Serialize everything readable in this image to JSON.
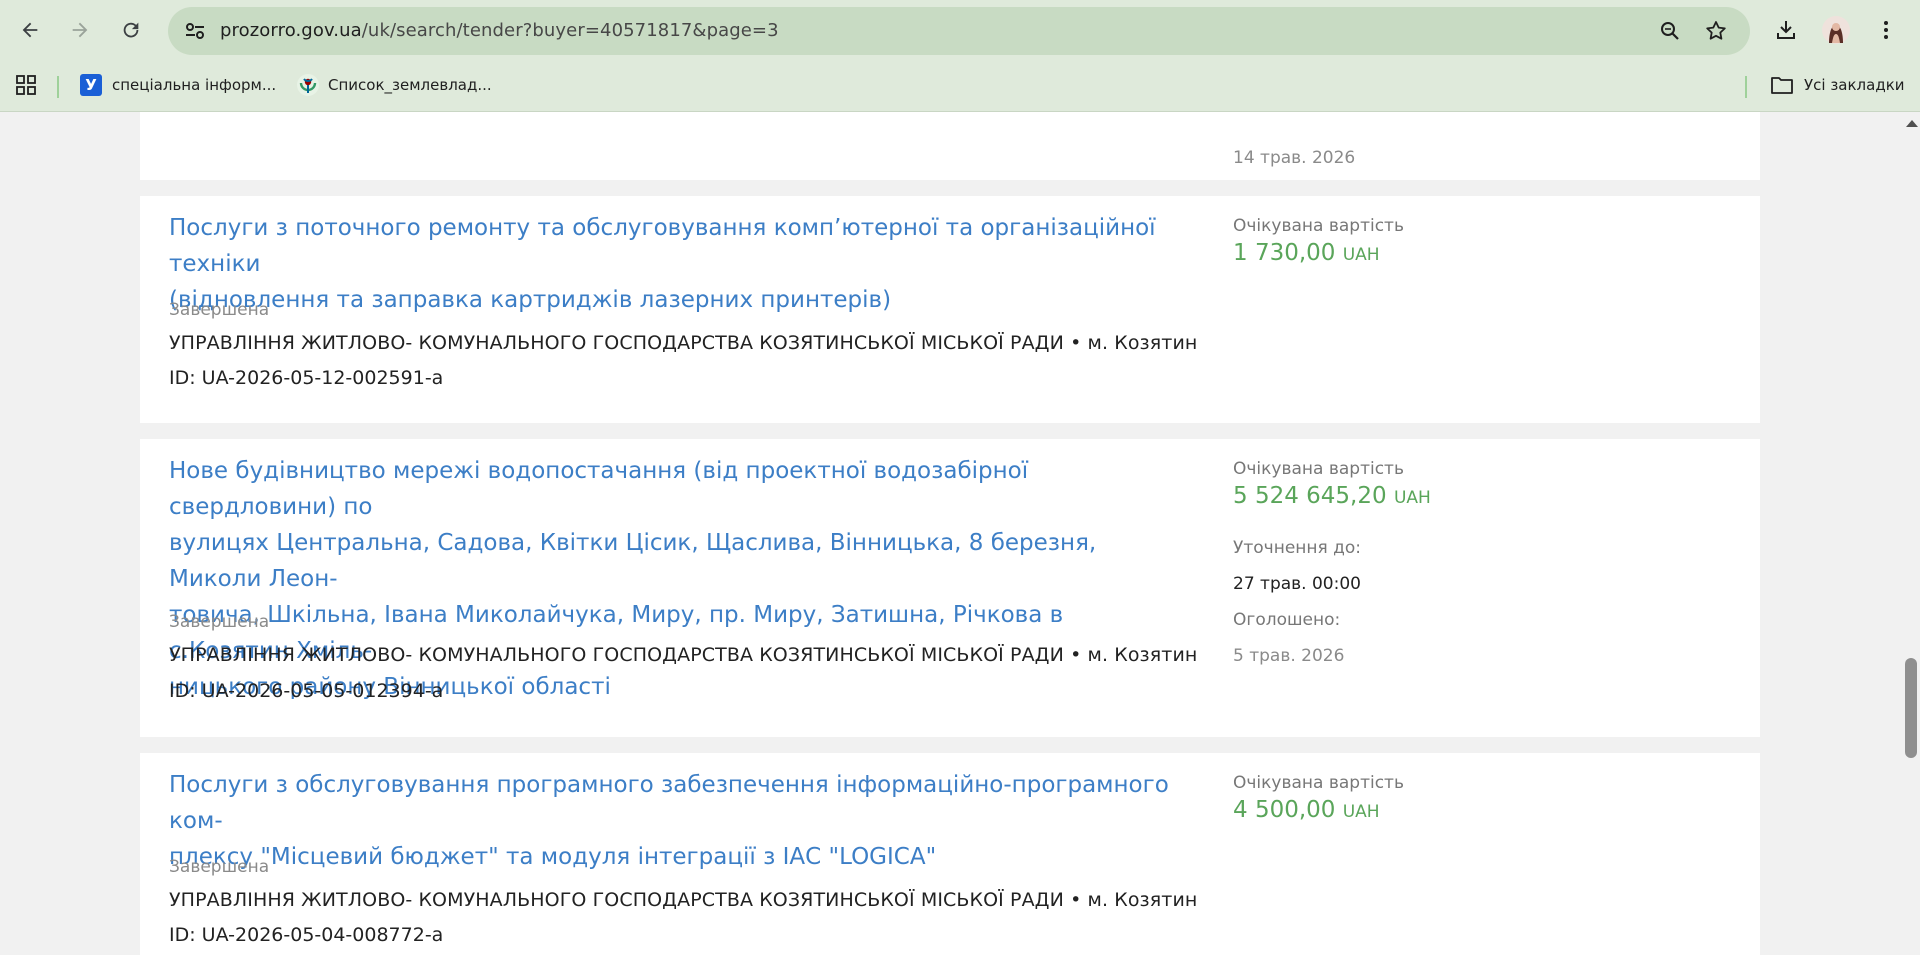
{
  "browser": {
    "url_domain": "prozorro.gov.ua",
    "url_path": "/uk/search/tender?buyer=40571817&page=3",
    "bookmarks": [
      {
        "label": "спеціальна інформ...",
        "favicon": "У"
      },
      {
        "label": "Список_землевлад...",
        "favicon": "wikimedia-icon"
      }
    ],
    "all_bookmarks_label": "Усі закладки"
  },
  "tenders": [
    {
      "partial_top": true,
      "date_value": "14 трав. 2026"
    },
    {
      "title": "Послуги з поточного ремонту та обслуговування комп’ютерної та організаційної техніки (відновлення та заправка картриджів лазерних принтерів)",
      "status": "Завершена",
      "buyer": "УПРАВЛІННЯ ЖИТЛОВО- КОМУНАЛЬНОГО ГОСПОДАРСТВА КОЗЯТИНСЬКОЇ МІСЬКОЇ РАДИ • м. Козятин",
      "id": "ID: UA-2026-05-12-002591-a",
      "amount_label": "Очікувана вартість",
      "amount": "1 730,00",
      "currency": "UAH"
    },
    {
      "title": "Нове будівництво мережі водопостачання (від проектної водозабірної свердловини) по вулицях Центральна, Садова, Квітки Цісик, Щаслива, Вінницька, 8 березня, Миколи Леон-товича, Шкільна, Івана Миколайчука, Миру, пр. Миру, Затишна, Річкова в с.Козятин Хміль-ницького району Вінницької області",
      "title_lines": [
        "Нове будівництво мережі водопостачання (від проектної водозабірної свердловини) по",
        "вулицях Центральна, Садова, Квітки Цісик, Щаслива, Вінницька, 8 березня, Миколи Леон-",
        "товича, Шкільна, Івана Миколайчука, Миру, пр. Миру, Затишна, Річкова в с.Козятин Хміль-",
        "ницького району Вінницької області"
      ],
      "status": "Завершена",
      "buyer": "УПРАВЛІННЯ ЖИТЛОВО- КОМУНАЛЬНОГО ГОСПОДАРСТВА КОЗЯТИНСЬКОЇ МІСЬКОЇ РАДИ • м. Козятин",
      "id": "ID: UA-2026-05-05-012394-a",
      "amount_label": "Очікувана вартість",
      "amount": "5 524 645,20",
      "currency": "UAH",
      "clarify_label": "Уточнення до:",
      "clarify_value": "27 трав. 00:00",
      "announced_label": "Оголошено:",
      "announced_value": "5 трав. 2026"
    },
    {
      "title_lines": [
        "Послуги з обслуговування програмного забезпечення інформаційно-програмного ком-",
        "плексу \"Місцевий бюджет\" та модуля інтеграції з ІАС \"LOGICA\""
      ],
      "status": "Завершена",
      "buyer": "УПРАВЛІННЯ ЖИТЛОВО- КОМУНАЛЬНОГО ГОСПОДАРСТВА КОЗЯТИНСЬКОЇ МІСЬКОЇ РАДИ • м. Козятин",
      "id": "ID: UA-2026-05-04-008772-a",
      "amount_label": "Очікувана вартість",
      "amount": "4 500,00",
      "currency": "UAH"
    }
  ],
  "title_lines_t1": [
    "Послуги з поточного ремонту та обслуговування комп’ютерної та організаційної техніки",
    "(відновлення та заправка картриджів лазерних принтерів)"
  ],
  "colors": {
    "chrome_bg": "#dfeadb",
    "link": "#3c7ec6",
    "amount": "#5aa55a"
  }
}
